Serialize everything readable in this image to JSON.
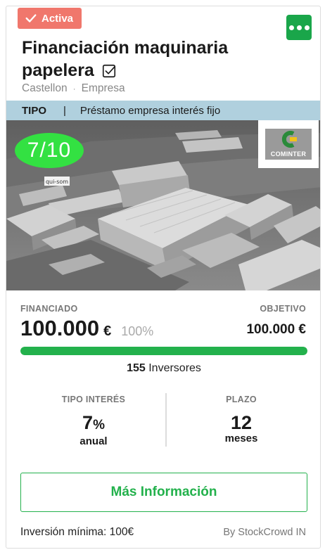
{
  "status": {
    "label": "Activa",
    "icon": "check-icon",
    "color": "#f0776c"
  },
  "menu": {
    "icon": "more-dots-icon",
    "color": "#1aa64a"
  },
  "title": "Financiación maquinaria papelera",
  "title_icon": "checkbox-checked-icon",
  "location": "Castellon",
  "category": "Empresa",
  "type": {
    "label": "TIPO",
    "separator": "|",
    "value": "Préstamo empresa interés fijo"
  },
  "image": {
    "description": "aerial-industrial-estate-photo",
    "sign_text": "qui-som"
  },
  "score": {
    "value": "7/10",
    "color": "#33e142"
  },
  "company_logo": {
    "text": "COMINTER",
    "icon": "cominter-logo-icon"
  },
  "funding": {
    "funded_label": "FINANCIADO",
    "funded_amount": "100.000",
    "currency": "€",
    "percent": "100%",
    "progress": 1.0,
    "objective_label": "OBJETIVO",
    "objective_amount": "100.000 €"
  },
  "investors": {
    "count": "155",
    "label": "Inversores"
  },
  "interest": {
    "label": "TIPO INTERÉS",
    "value": "7",
    "unit_symbol": "%",
    "unit": "anual"
  },
  "term": {
    "label": "PLAZO",
    "value": "12",
    "unit": "meses"
  },
  "cta": {
    "label": "Más Información",
    "color": "#23b14c"
  },
  "footer": {
    "min_investment": "Inversión mínima: 100€",
    "platform": "By StockCrowd IN"
  }
}
